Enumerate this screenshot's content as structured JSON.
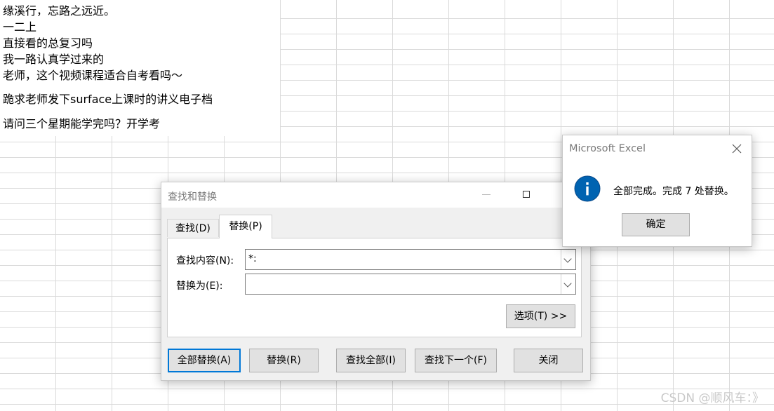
{
  "sheet": {
    "lines": [
      "缘溪行，忘路之远近。",
      "一二上",
      "直接看的总复习吗",
      "我一路认真学过来的",
      "老师，这个视频课程适合自考看吗～",
      "跪求老师发下surface上课时的讲义电子档",
      "请问三个星期能学完吗？开学考"
    ]
  },
  "find_replace": {
    "title": "查找和替换",
    "tabs": {
      "find": "查找(D)",
      "replace": "替换(P)"
    },
    "find_label": "查找内容(N):",
    "find_value": "*:",
    "replace_label": "替换为(E):",
    "replace_value": "",
    "options_button": "选项(T) >>",
    "buttons": {
      "replace_all": "全部替换(A)",
      "replace": "替换(R)",
      "find_all": "查找全部(I)",
      "find_next": "查找下一个(F)",
      "close": "关闭"
    }
  },
  "msgbox": {
    "title": "Microsoft Excel",
    "icon": "info-icon",
    "message": "全部完成。完成 7 处替换。",
    "ok": "确定"
  },
  "watermark": "CSDN @顺风车：》",
  "colors": {
    "accent": "#0078d7",
    "info_icon": "#0063b1"
  }
}
